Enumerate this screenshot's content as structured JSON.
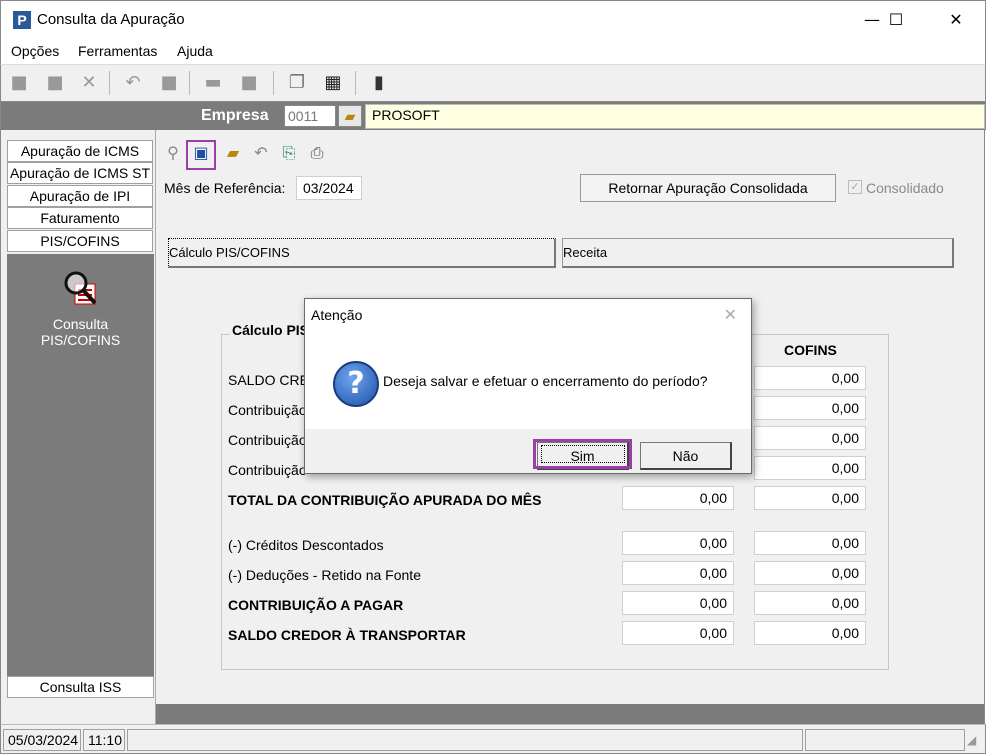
{
  "window": {
    "title": "Consulta da Apuração",
    "controls": [
      "—",
      "☐",
      "✕"
    ]
  },
  "menu": {
    "items": [
      {
        "label": "Opções",
        "underline": "O"
      },
      {
        "label": "Ferramentas",
        "underline": "F"
      },
      {
        "label": "Ajuda",
        "underline": "A"
      }
    ]
  },
  "empresa": {
    "label": "Empresa",
    "code": "0011",
    "name": "PROSOFT"
  },
  "sidebar": {
    "tabs": [
      "Apuração de ICMS",
      "Apuração de ICMS ST",
      "Apuração de IPI",
      "Faturamento",
      "PIS/COFINS"
    ],
    "panel_item_label_1": "Consulta",
    "panel_item_label_2": "PIS/COFINS",
    "bottom_tab": "Consulta ISS"
  },
  "main": {
    "mes_label": "Mês de Referência:",
    "mes_value": "03/2024",
    "retornar_label": "Retornar Apuração Consolidada",
    "consolidado_label": "Consolidado",
    "consolidado_checked": true,
    "tabs": [
      "Cálculo PIS/COFINS",
      "Receita"
    ],
    "group_title": "Cálculo PIS",
    "col_cofins": "COFINS",
    "rows": [
      {
        "label": "SALDO CRED",
        "bold": false,
        "pis": "",
        "cofins": "0,00"
      },
      {
        "label": "Contribuição",
        "bold": false,
        "pis": "",
        "cofins": "0,00"
      },
      {
        "label": "Contribuição",
        "bold": false,
        "pis": "",
        "cofins": "0,00"
      },
      {
        "label": "Contribuição",
        "bold": false,
        "pis": "",
        "cofins": "0,00"
      },
      {
        "label": "TOTAL DA CONTRIBUIÇÃO APURADA DO MÊS",
        "bold": true,
        "pis": "0,00",
        "cofins": "0,00"
      },
      {
        "label": "(-) Créditos Descontados",
        "bold": false,
        "pis": "0,00",
        "cofins": "0,00"
      },
      {
        "label": "(-) Deduções - Retido na Fonte",
        "bold": false,
        "pis": "0,00",
        "cofins": "0,00"
      },
      {
        "label": "CONTRIBUIÇÃO A PAGAR",
        "bold": true,
        "pis": "0,00",
        "cofins": "0,00"
      },
      {
        "label": "SALDO CREDOR À TRANSPORTAR",
        "bold": true,
        "pis": "0,00",
        "cofins": "0,00"
      }
    ]
  },
  "dialog": {
    "title": "Atenção",
    "message": "Deseja salvar e efetuar o encerramento do período?",
    "yes_label": "Sim",
    "no_label": "Não"
  },
  "status": {
    "date": "05/03/2024",
    "time": "11:10"
  },
  "colors": {
    "highlight": "#9b3fa8",
    "empresa_bar": "#7b7b7b",
    "empresa_name_bg": "#ffffe1"
  }
}
